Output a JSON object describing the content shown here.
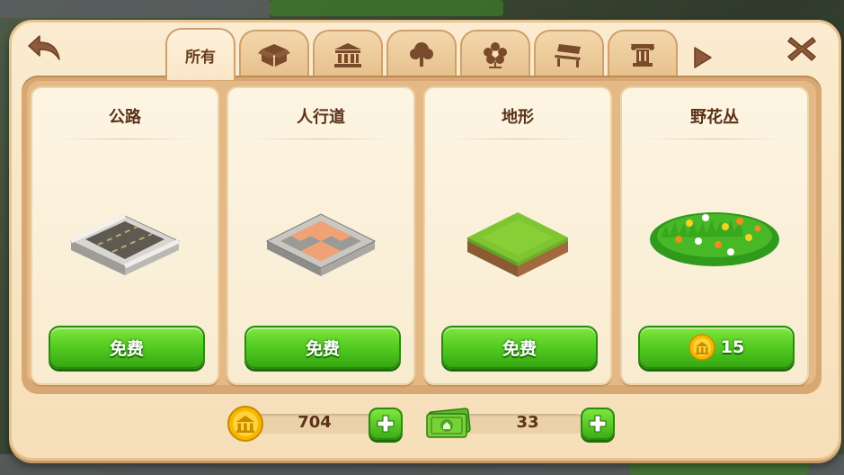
{
  "tabs": [
    {
      "label": "所有",
      "icon": "all-text",
      "active": true
    },
    {
      "label": "",
      "icon": "box-icon"
    },
    {
      "label": "",
      "icon": "landmark-icon"
    },
    {
      "label": "",
      "icon": "tree-icon"
    },
    {
      "label": "",
      "icon": "flower-icon"
    },
    {
      "label": "",
      "icon": "bench-icon"
    },
    {
      "label": "",
      "icon": "column-icon"
    }
  ],
  "items": [
    {
      "title": "公路",
      "price_label": "免费",
      "art": "road-tile"
    },
    {
      "title": "人行道",
      "price_label": "免费",
      "art": "sidewalk-tile"
    },
    {
      "title": "地形",
      "price_label": "免费",
      "art": "grass-terrain-tile"
    },
    {
      "title": "野花丛",
      "price_label": "15",
      "art": "wildflower-patch",
      "price_currency": "coin"
    }
  ],
  "currency": {
    "coins": "704",
    "cash": "33"
  },
  "colors": {
    "accent_green": "#4fc81f",
    "panel_bg": "#fbebd0",
    "text_brown": "#5a3218",
    "coin_gold": "#f5b800"
  }
}
